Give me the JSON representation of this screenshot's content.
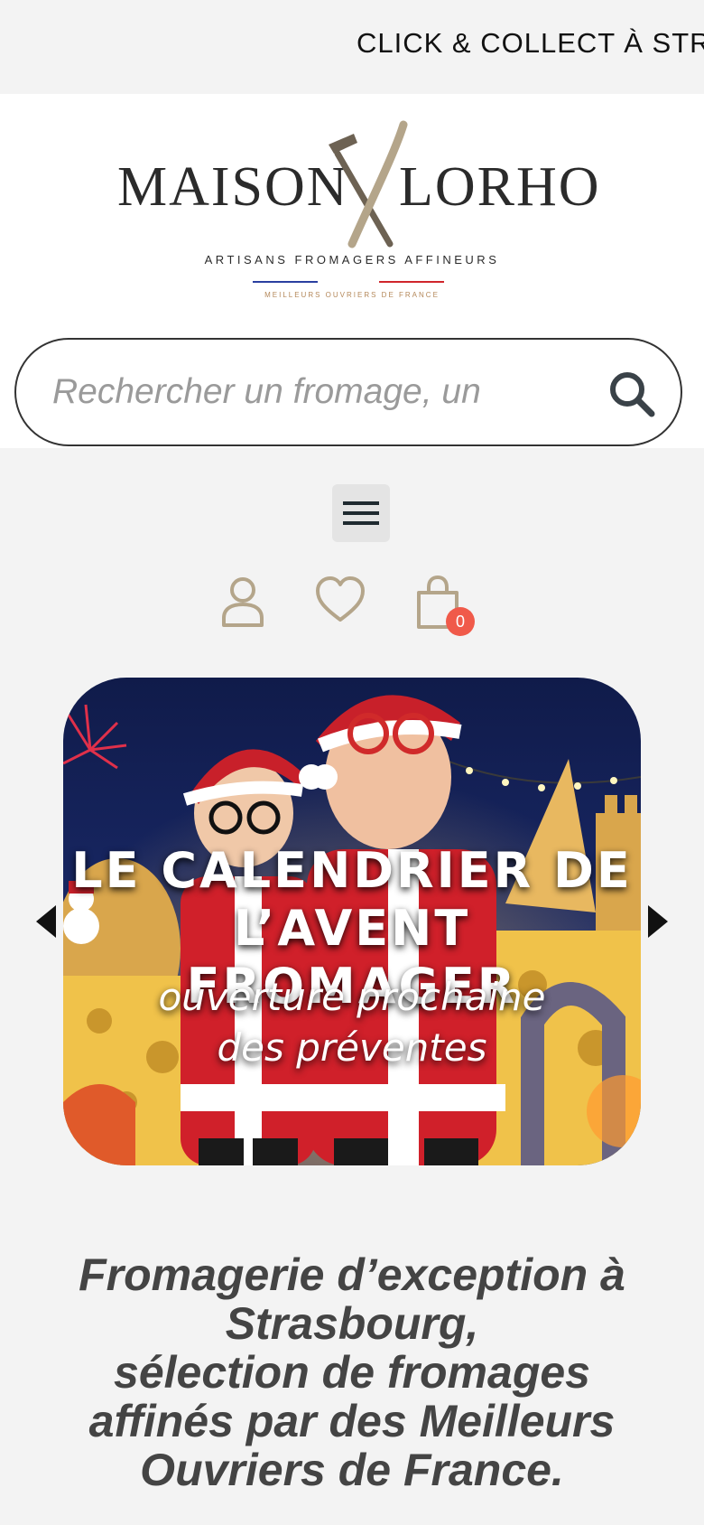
{
  "announcement": {
    "text": "CLICK & COLLECT À STRA"
  },
  "logo": {
    "name_left": "MAISON",
    "name_right": "LORHO",
    "tagline": "ARTISANS FROMAGERS AFFINEURS",
    "mof": "MEILLEURS OUVRIERS DE FRANCE"
  },
  "search": {
    "placeholder": "Rechercher un fromage, un"
  },
  "icons": {
    "menu": "hamburger-icon",
    "search": "search-icon",
    "account": "user-icon",
    "wishlist": "heart-icon",
    "cart": "shopping-bag-icon"
  },
  "cart": {
    "count": "0"
  },
  "hero": {
    "title_line1": "LE CALENDRIER DE",
    "title_line2": "L’AVENT FROMAGER",
    "subtitle_line1": "ouverture prochaine",
    "subtitle_line2": "des préventes"
  },
  "intro": {
    "line1": "Fromagerie d’exception à Strasbourg,",
    "line2": "sélection de fromages affinés par des Meilleurs Ouvriers de France."
  },
  "colors": {
    "accent": "#b4a58a",
    "badge": "#f05a4a",
    "text": "#444444"
  }
}
